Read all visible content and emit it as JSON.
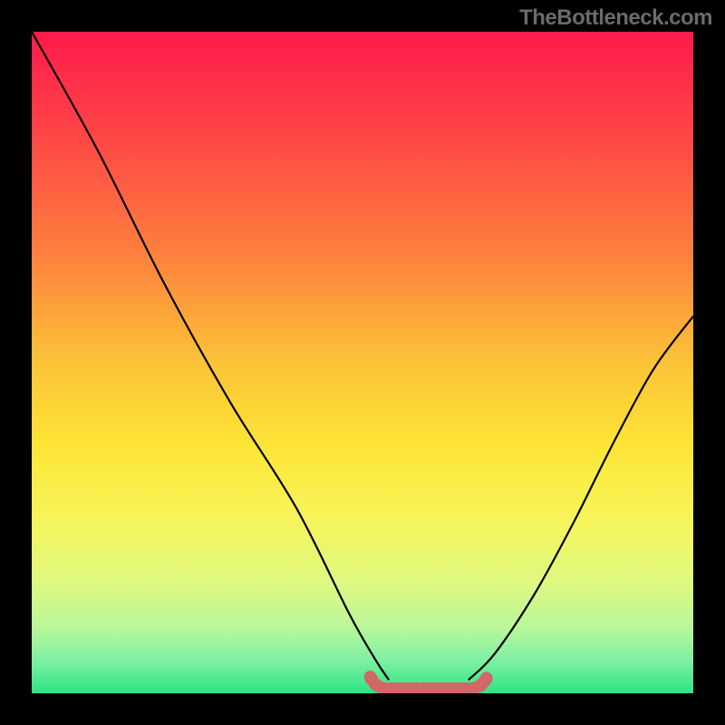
{
  "watermark": "TheBottleneck.com",
  "chart_data": {
    "type": "line",
    "title": "",
    "xlabel": "",
    "ylabel": "",
    "x_range": [
      0,
      100
    ],
    "y_range": [
      0,
      100
    ],
    "series": [
      {
        "name": "left-curve",
        "x": [
          0,
          10,
          20,
          30,
          40,
          48,
          52,
          54
        ],
        "y": [
          100,
          82,
          62,
          44,
          28,
          12,
          5,
          2
        ]
      },
      {
        "name": "right-curve",
        "x": [
          66,
          70,
          76,
          82,
          88,
          94,
          100
        ],
        "y": [
          2,
          6,
          15,
          26,
          38,
          49,
          57
        ]
      }
    ],
    "green_band": {
      "x_start": 52,
      "x_end": 68,
      "y": 0
    },
    "gradient_stops": [
      {
        "pos": 0.0,
        "color": "#ff1a4b"
      },
      {
        "pos": 0.15,
        "color": "#ff4447"
      },
      {
        "pos": 0.33,
        "color": "#fd7e3e"
      },
      {
        "pos": 0.5,
        "color": "#fbc337"
      },
      {
        "pos": 0.63,
        "color": "#fde636"
      },
      {
        "pos": 0.74,
        "color": "#f6f55c"
      },
      {
        "pos": 0.83,
        "color": "#e0f880"
      },
      {
        "pos": 0.9,
        "color": "#baf799"
      },
      {
        "pos": 0.95,
        "color": "#7ff0a3"
      },
      {
        "pos": 1.0,
        "color": "#2de583"
      }
    ],
    "optimum_marker_color": "#d16767",
    "curve_color": "#000000"
  }
}
